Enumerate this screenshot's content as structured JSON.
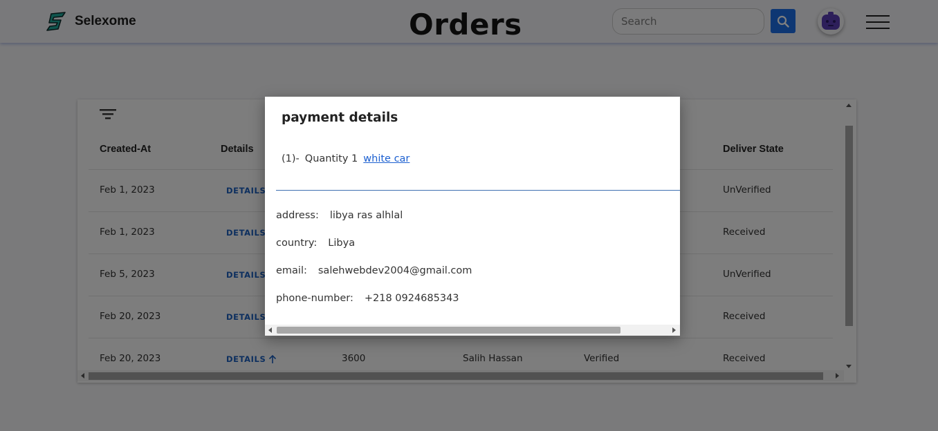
{
  "header": {
    "brand_name": "Selexome",
    "page_title": "Orders",
    "search_placeholder": "Search",
    "icons": [
      "brand-logo-icon",
      "search-icon",
      "avatar-robot-icon",
      "hamburger-menu-icon"
    ],
    "accent_color": "#1c6fe6"
  },
  "table": {
    "columns": [
      "Created-At",
      "Details",
      "",
      "",
      "",
      "Deliver State"
    ],
    "details_label": "DETAILS",
    "rows": [
      {
        "created_at": "Feb 1, 2023",
        "deliver_state": "UnVerified"
      },
      {
        "created_at": "Feb 1, 2023",
        "deliver_state": "Received"
      },
      {
        "created_at": "Feb 5, 2023",
        "deliver_state": "UnVerified"
      },
      {
        "created_at": "Feb 20, 2023",
        "deliver_state": "Received"
      },
      {
        "created_at": "Feb 20, 2023",
        "total": "3600",
        "customer": "Salih Hassan",
        "payment_state": "Verified",
        "deliver_state": "Received"
      }
    ]
  },
  "modal": {
    "title": "payment details",
    "order_index": "(1)-",
    "quantity_text": "Quantity 1",
    "product_link": "white car",
    "address_label": "address:",
    "address_value": "libya ras alhlal",
    "country_label": "country:",
    "country_value": "Libya",
    "email_label": "email:",
    "email_value": "salehwebdev2004@gmail.com",
    "phone_label": "phone-number:",
    "phone_value": "+218 0924685343"
  }
}
